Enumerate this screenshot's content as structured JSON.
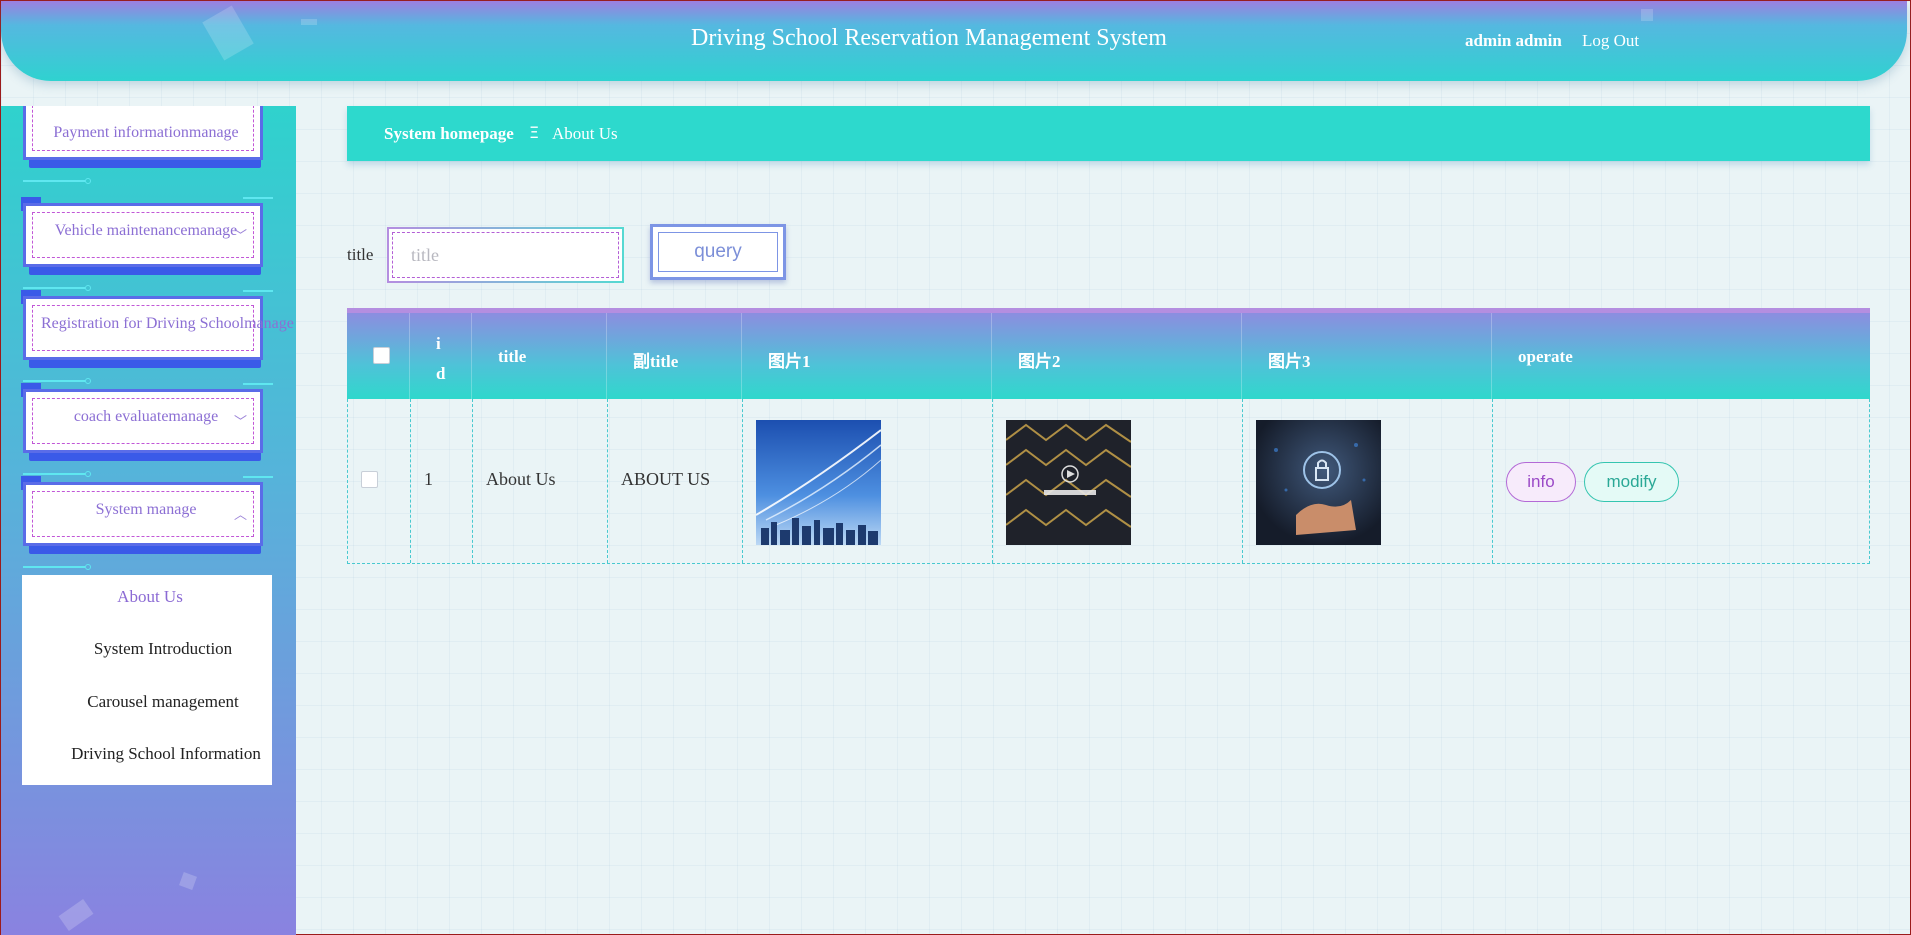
{
  "header": {
    "title": "Driving School Reservation Management System",
    "user": "admin admin",
    "logout": "Log Out"
  },
  "sidebar": {
    "items": [
      {
        "label": "Payment informationmanage",
        "icon": "chevron-down-icon"
      },
      {
        "label": "Vehicle maintenancemanage",
        "icon": "chevron-down-icon"
      },
      {
        "label": "Registration for Driving Schoolmanage",
        "icon": "chevron-down-icon"
      },
      {
        "label": "coach evaluatemanage",
        "icon": "chevron-down-icon"
      },
      {
        "label": "System manage",
        "icon": "chevron-up-icon"
      }
    ],
    "submenu": [
      {
        "label": "About Us",
        "active": true
      },
      {
        "label": "System Introduction",
        "active": false
      },
      {
        "label": "Carousel management",
        "active": false
      },
      {
        "label": "Driving School Information",
        "active": false
      }
    ]
  },
  "breadcrumb": {
    "home": "System homepage",
    "separator": "Ξ",
    "current": "About Us"
  },
  "search": {
    "label": "title",
    "placeholder": "title",
    "value": "",
    "button": "query"
  },
  "table": {
    "columns": [
      "",
      "id",
      "title",
      "副title",
      "图片1",
      "图片2",
      "图片3",
      "operate"
    ],
    "rows": [
      {
        "id": "1",
        "title": "About Us",
        "subtitle": "ABOUT US",
        "images": [
          "city-skyline-image",
          "gold-cubes-image",
          "security-lock-image"
        ],
        "actions": [
          "info",
          "modify"
        ]
      }
    ]
  },
  "colors": {
    "accent": "#2dd9cd",
    "purple": "#8c6fd4",
    "header_gradient_top": "#9c7fe0"
  }
}
